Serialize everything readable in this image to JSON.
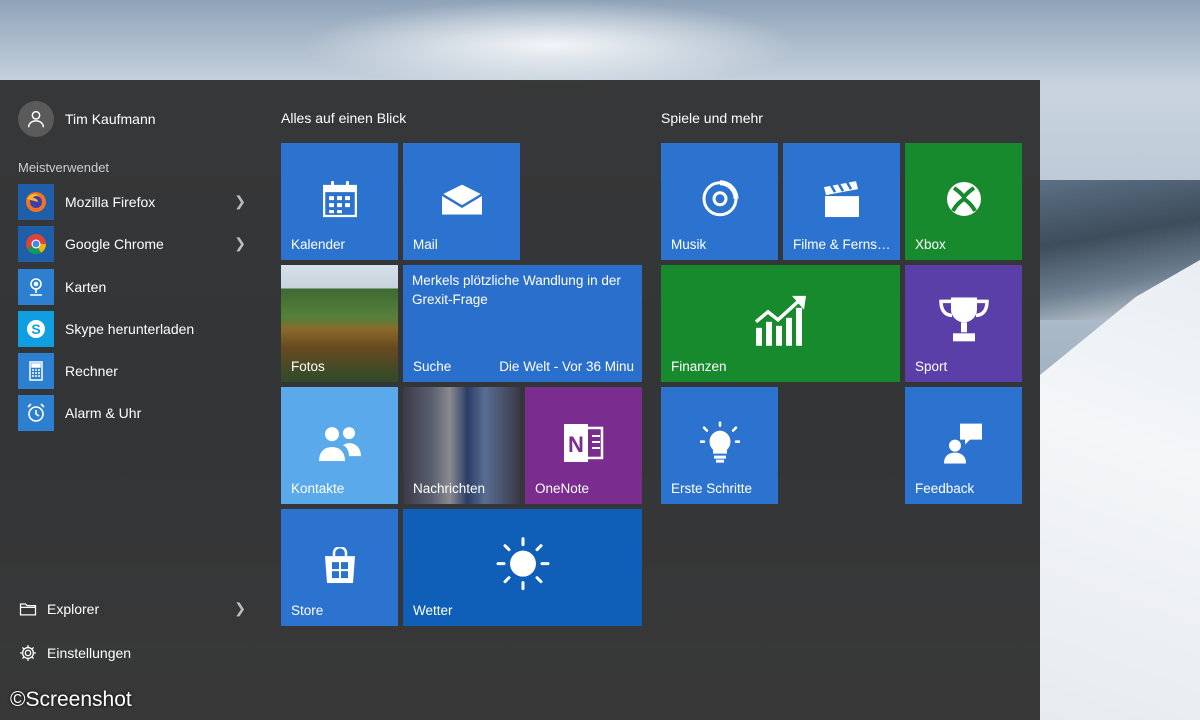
{
  "user": {
    "name": "Tim Kaufmann"
  },
  "left_panel": {
    "section_label": "Meistverwendet",
    "apps": [
      {
        "label": "Mozilla Firefox",
        "icon": "firefox-icon",
        "has_submenu": true
      },
      {
        "label": "Google Chrome",
        "icon": "chrome-icon",
        "has_submenu": true
      },
      {
        "label": "Karten",
        "icon": "maps-icon",
        "has_submenu": false
      },
      {
        "label": "Skype herunterladen",
        "icon": "skype-icon",
        "has_submenu": false
      },
      {
        "label": "Rechner",
        "icon": "calculator-icon",
        "has_submenu": false
      },
      {
        "label": "Alarm & Uhr",
        "icon": "alarm-clock-icon",
        "has_submenu": false
      }
    ],
    "explorer_label": "Explorer",
    "settings_label": "Einstellungen"
  },
  "groups": {
    "left_title": "Alles auf einen Blick",
    "right_title": "Spiele und mehr"
  },
  "tiles": {
    "kalender": "Kalender",
    "mail": "Mail",
    "fotos": "Fotos",
    "suche": "Suche",
    "news_headline": "Merkels plötzliche Wandlung in der Grexit-Frage",
    "news_source": "Die Welt - Vor 36 Minu",
    "kontakte": "Kontakte",
    "nachrichten": "Nachrichten",
    "onenote": "OneNote",
    "store": "Store",
    "wetter": "Wetter",
    "musik": "Musik",
    "filme": "Filme & Ferns…",
    "xbox": "Xbox",
    "finanzen": "Finanzen",
    "sport": "Sport",
    "erste_schritte": "Erste Schritte",
    "feedback": "Feedback"
  },
  "colors": {
    "tile_blue": "#2b73cf",
    "tile_green": "#188a2e",
    "tile_purple": "#7a2d8f",
    "tile_violet": "#5b3fa8",
    "tile_light_blue": "#5aa9ea",
    "tile_dark_blue": "#0f5fb8"
  },
  "watermark": "©Screenshot"
}
